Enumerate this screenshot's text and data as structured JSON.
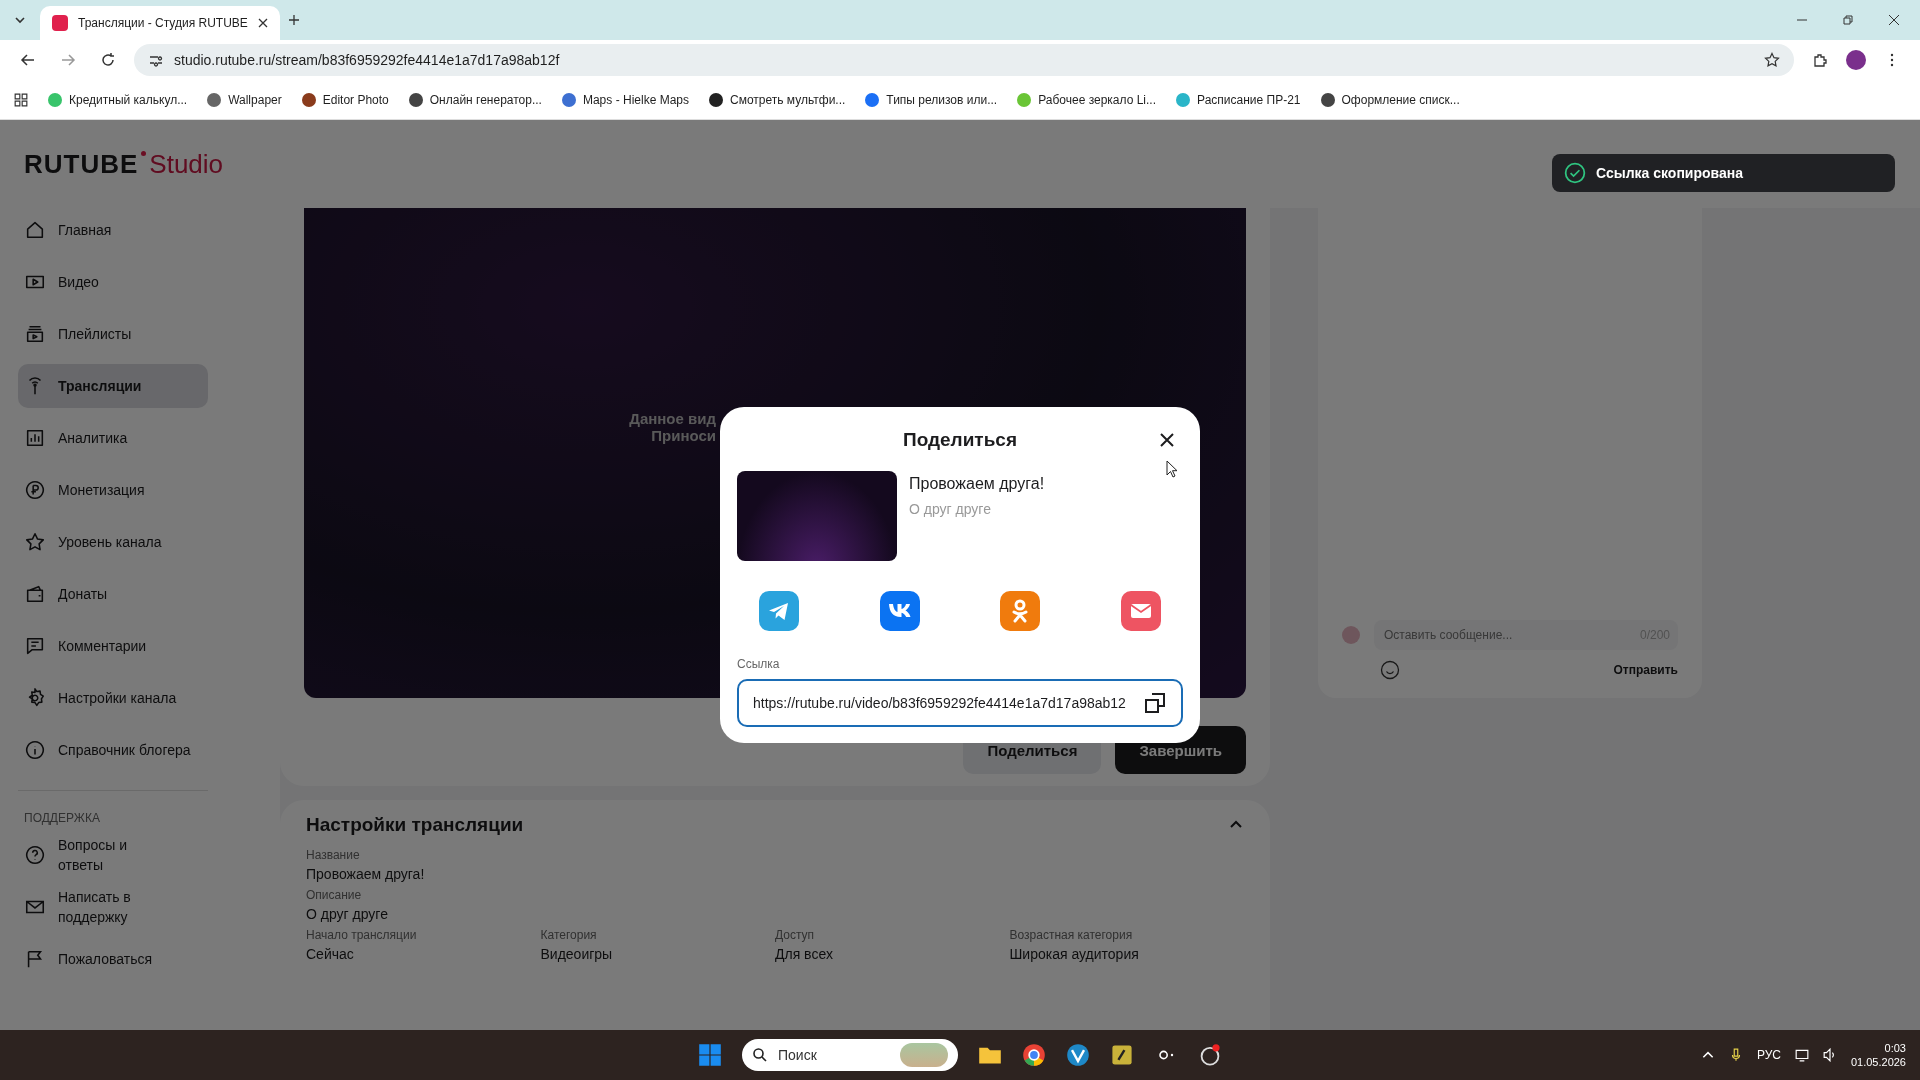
{
  "browser": {
    "tab_title": "Трансляции - Студия RUTUBE",
    "url": "studio.rutube.ru/stream/b83f6959292fe4414e1a7d17a98ab12f",
    "bookmarks": [
      "Кредитный калькул...",
      "Wallpaper",
      "Editor Photo",
      "Онлайн генератор...",
      "Maps - Hielke Maps",
      "Смотреть мультфи...",
      "Типы релизов или...",
      "Рабочее зеркало Li...",
      "Расписание ПР-21",
      "Оформление списк..."
    ]
  },
  "logo": {
    "brand": "RUTUBE",
    "product": "Studio"
  },
  "sidebar": {
    "items": [
      {
        "label": "Главная",
        "selected": false
      },
      {
        "label": "Видео",
        "selected": false
      },
      {
        "label": "Плейлисты",
        "selected": false
      },
      {
        "label": "Трансляции",
        "selected": true
      },
      {
        "label": "Аналитика",
        "selected": false
      },
      {
        "label": "Монетизация",
        "selected": false
      },
      {
        "label": "Уровень канала",
        "selected": false
      },
      {
        "label": "Донаты",
        "selected": false
      },
      {
        "label": "Комментарии",
        "selected": false
      },
      {
        "label": "Настройки канала",
        "selected": false
      },
      {
        "label": "Справочник блогера",
        "selected": false
      }
    ],
    "support_heading": "ПОДДЕРЖКА",
    "support_items": [
      "Вопросы и ответы",
      "Написать в поддержку",
      "Пожаловаться"
    ]
  },
  "player": {
    "message_lines": [
      "Данное вид",
      "Приноси"
    ]
  },
  "actions": [
    "Поделиться",
    "Завершить"
  ],
  "chat": {
    "placeholder": "Оставить сообщение...",
    "counter": "0/200",
    "send": "Отправить"
  },
  "settings": {
    "title": "Настройки трансляции",
    "expanded": true,
    "fields": [
      {
        "label": "Название",
        "value": "Провожаем друга!"
      },
      {
        "label": "Описание",
        "value": "О друг друге"
      }
    ],
    "grid": [
      {
        "label": "Начало трансляции",
        "value": "Сейчас"
      },
      {
        "label": "Категория",
        "value": "Видеоигры"
      },
      {
        "label": "Доступ",
        "value": "Для всех"
      },
      {
        "label": "Возрастная категория",
        "value": "Широкая аудитория"
      }
    ]
  },
  "share_dialog": {
    "title": "Поделиться",
    "video_title": "Провожаем друга!",
    "video_description": "О друг друге",
    "link_label": "Ссылка",
    "link": "https://rutube.ru/video/b83f6959292fe4414e1a7d17a98ab12"
  },
  "toast": {
    "message": "Ссылка скопирована"
  },
  "taskbar": {
    "search_placeholder": "Поиск",
    "language": "РУС",
    "time": "0:03",
    "date": "01.05.2026"
  }
}
